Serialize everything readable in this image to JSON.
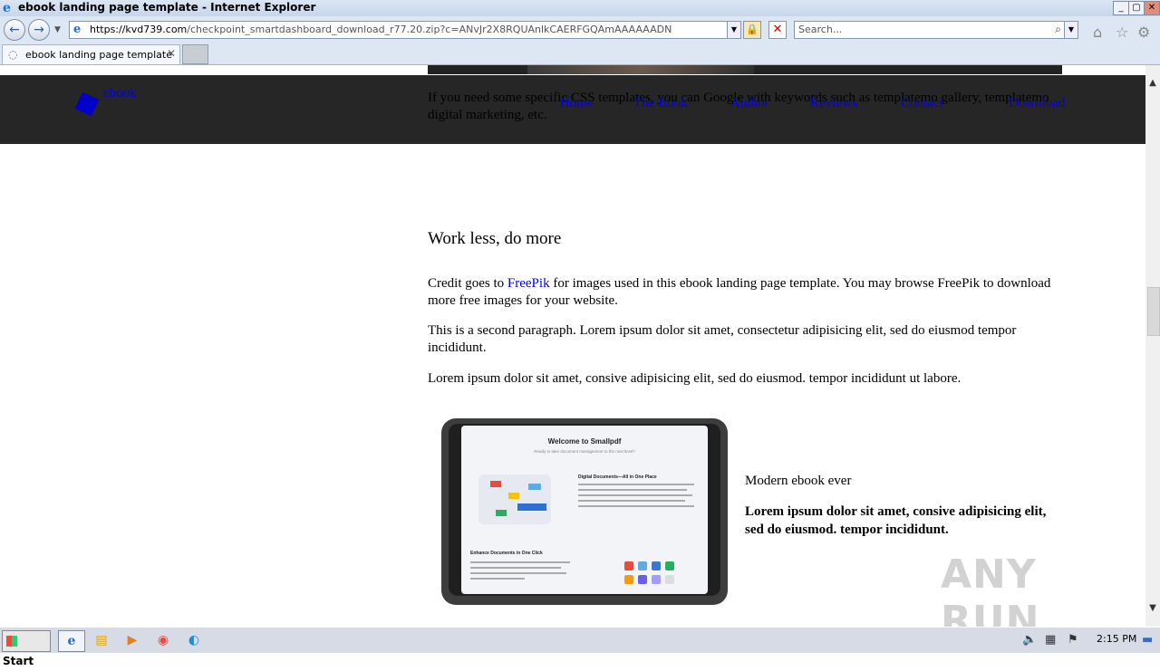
{
  "window": {
    "title": "ebook landing page template - Internet Explorer",
    "min": "_",
    "max": "▢",
    "close": "✕"
  },
  "browser": {
    "url_host": "https://kvd739.com",
    "url_path": "/checkpoint_smartdashboard_download_r77.20.zip?c=ANvJr2X8RQUAnlkCAERFGQAmAAAAAADN",
    "search_placeholder": "Search..."
  },
  "tab": {
    "title": "ebook landing page template"
  },
  "page": {
    "overlay_text": "If you need some specific CSS templates, you can Google with keywords such as templatemo gallery, templatemo digital marketing, etc.",
    "brand": "ebook",
    "nav": [
      "Home",
      "The Book",
      "Author",
      "Reviews",
      "Contact",
      "Download"
    ],
    "heading": "Work less, do more",
    "para1_pre": "Credit goes to ",
    "para1_link": "FreePik",
    "para1_post": " for images used in this ebook landing page template. You may browse FreePik to download more free images for your website.",
    "para2": "This is a second paragraph. Lorem ipsum dolor sit amet, consectetur adipisicing elit, sed do eiusmod tempor incididunt.",
    "para3": "Lorem ipsum dolor sit amet, consive adipisicing elit, sed do eiusmod. tempor incididunt ut labore.",
    "side_title": "Modern ebook ever",
    "side_bold": "Lorem ipsum dolor sit amet, consive adipisicing elit, sed do eiusmod. tempor incididunt."
  },
  "tablet_screen": {
    "title": "Welcome to Smallpdf",
    "subtitle": "Ready to take document management to the next level?",
    "section1": "Digital Documents—All in One Place",
    "section1_body": "With the new Smallpdf experience, you can freely upload, organize, and share digital documents. When you enable the 'Storage' option, we'll store all of your processed files here.",
    "section2": "Enhance Documents in One Click",
    "section2_body": "Allow you digital documents, we'll present you with an array of options to convert, compress, or modify it."
  },
  "watermark": "ANY RUN",
  "taskbar": {
    "start": "Start",
    "clock": "2:15 PM"
  }
}
